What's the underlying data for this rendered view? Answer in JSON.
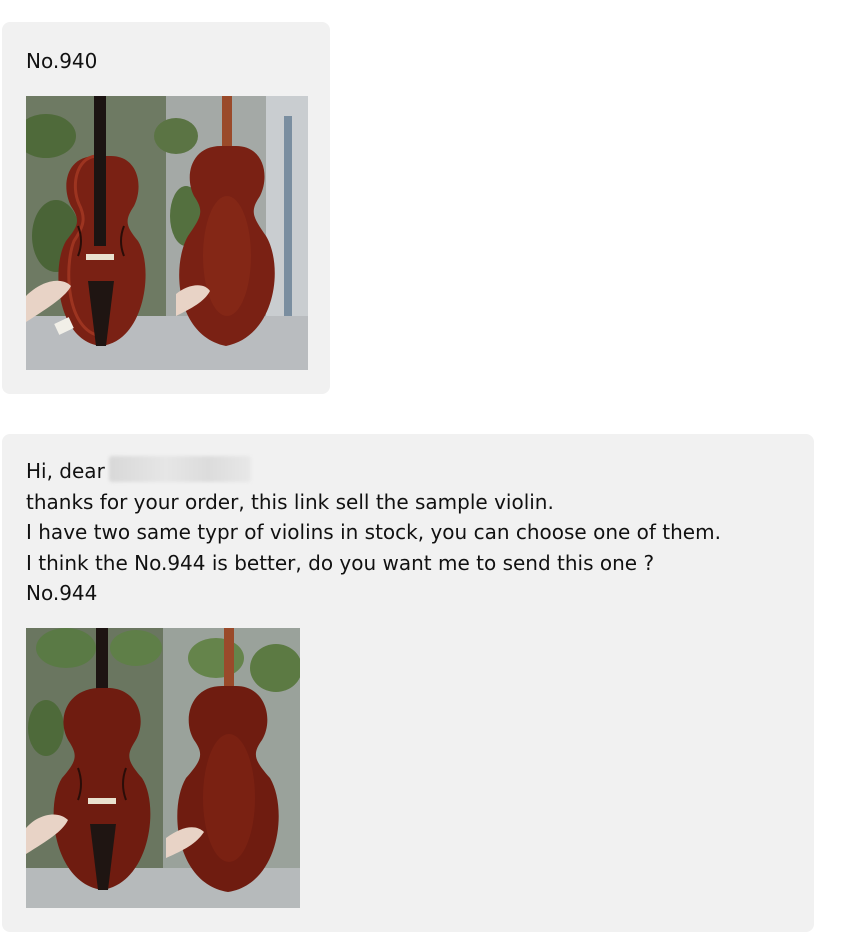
{
  "messages": [
    {
      "label": "No.940",
      "photo_icon": "violin-photo-icon"
    },
    {
      "greeting": "Hi, dear",
      "greeting_redacted_name": "redacted-name",
      "lines": [
        "thanks for your order, this link sell the sample violin.",
        "I have two same typr of violins in stock, you can choose one of them.",
        "I think the No.944 is better, do you want me to send this one ?",
        "No.944"
      ],
      "photo_icon": "violin-photo-icon"
    }
  ],
  "colors": {
    "bubble_bg": "#f1f1f1",
    "page_bg": "#ffffff",
    "violin_wood": "#7a2114"
  }
}
